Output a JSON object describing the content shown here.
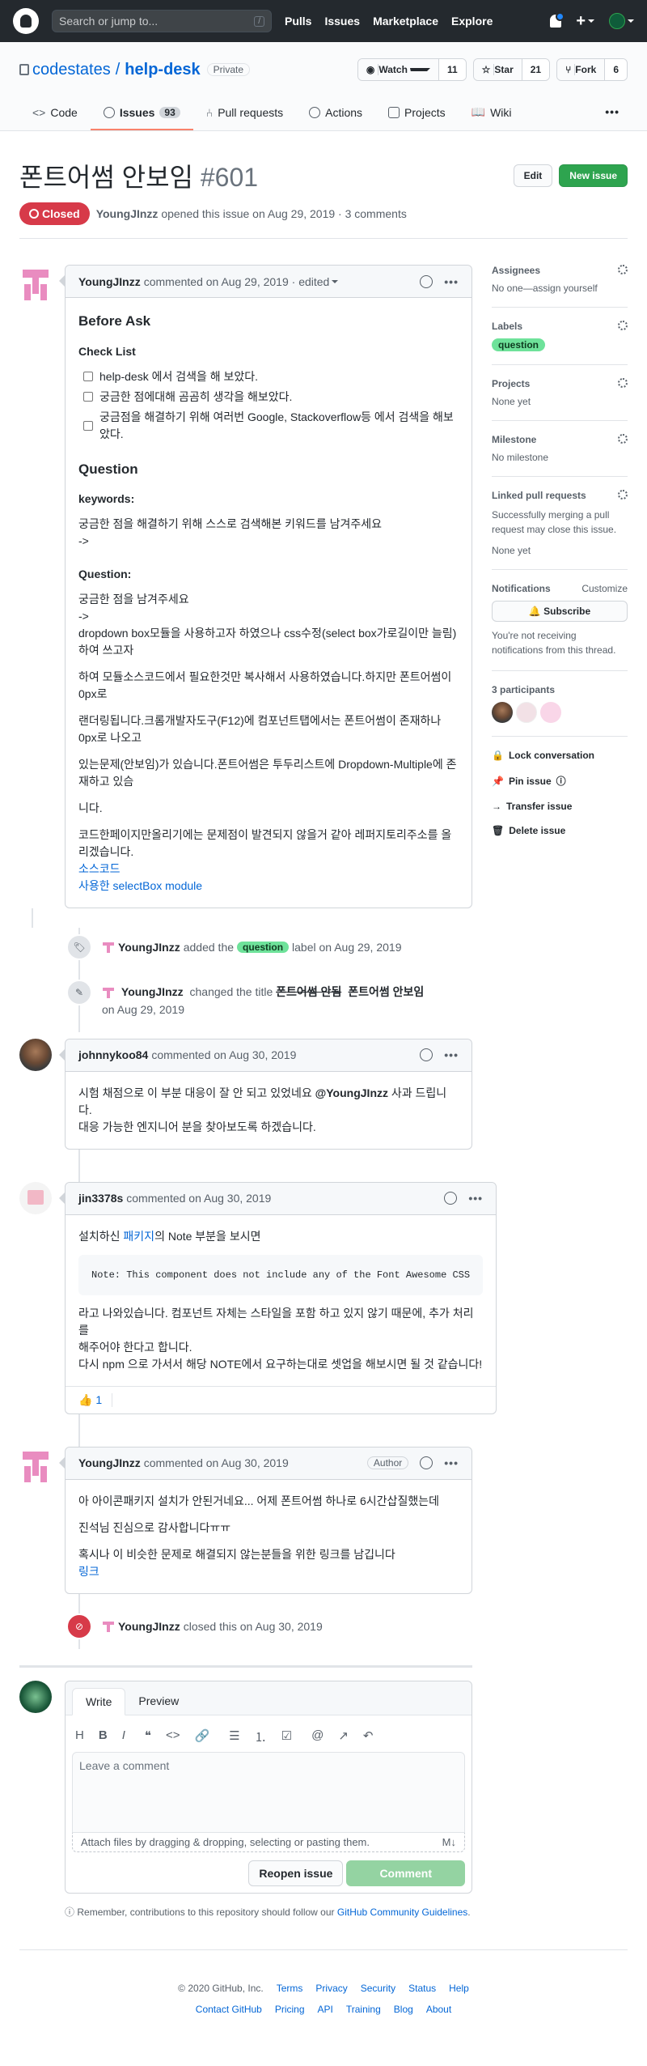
{
  "header": {
    "search_placeholder": "Search or jump to...",
    "slash": "/",
    "nav": [
      "Pulls",
      "Issues",
      "Marketplace",
      "Explore"
    ],
    "plus": "+"
  },
  "repo": {
    "owner": "codestates",
    "name": "help-desk",
    "visibility": "Private",
    "watch_label": "Watch",
    "watch_count": "11",
    "star_label": "Star",
    "star_count": "21",
    "fork_label": "Fork",
    "fork_count": "6",
    "tabs": [
      {
        "label": "Code"
      },
      {
        "label": "Issues",
        "count": "93"
      },
      {
        "label": "Pull requests"
      },
      {
        "label": "Actions"
      },
      {
        "label": "Projects"
      },
      {
        "label": "Wiki"
      }
    ],
    "more": "•••"
  },
  "issue": {
    "title": "폰트어썸 안보임",
    "number": "#601",
    "edit_label": "Edit",
    "new_issue_label": "New issue",
    "state": "Closed",
    "author": "YoungJInzz",
    "meta_text": "opened this issue on Aug 29, 2019 · 3 comments"
  },
  "first_comment": {
    "author": "YoungJInzz",
    "meta": "commented on Aug 29, 2019 · edited",
    "h_before": "Before Ask",
    "h_checklist": "Check List",
    "checklist": [
      "help-desk 에서 검색을 해 보았다.",
      "궁금한 점에대해 곰곰히 생각을 해보았다.",
      "궁금점을 해결하기 위해 여러번 Google, Stackoverflow등 에서 검색을 해보았다."
    ],
    "h_question": "Question",
    "h_keywords": "keywords:",
    "keywords_text": "궁금한 점을 해결하기 위해 스스로 검색해본 키워드를 남겨주세요",
    "arrow1": "->",
    "h_question2": "Question:",
    "q_text": "궁금한 점을 남겨주세요",
    "arrow2": "->",
    "p1": "dropdown box모듈을 사용하고자 하였으나 css수정(select box가로길이만 늘림)하여 쓰고자",
    "p2": "하여 모듈소스코드에서 필요한것만 복사해서 사용하였습니다.하지만 폰트어썸이 0px로",
    "p3": "랜더링됩니다.크롬개발자도구(F12)에 컴포넌트탭에서는 폰트어썸이 존재하나 0px로 나오고",
    "p4": "있는문제(안보임)가 있습니다.폰트어썸은 투두리스트에 Dropdown-Multiple에 존재하고 있슴",
    "p5": "니다.",
    "p6": "코드한페이지만올리기에는 문제점이 발견되지 않을거 같아 레퍼지토리주소를 올리겠습니다.",
    "link1": "소스코드",
    "link2": "사용한 selectBox module"
  },
  "event_label": {
    "actor": "YoungJInzz",
    "pre": "added the",
    "label": "question",
    "post": "label on Aug 29, 2019"
  },
  "event_rename": {
    "actor": "YoungJInzz",
    "pre": "changed the title",
    "old": "폰트어썸 안됨",
    "new": "폰트어썸 안보임",
    "date": "on Aug 29, 2019"
  },
  "comment2": {
    "author": "johnnykoo84",
    "meta": "commented on Aug 30, 2019",
    "line1_pre": "시험 채점으로 이 부분 대응이 잘 안 되고 있었네요",
    "mention": "@YoungJInzz",
    "line1_post": "사과 드립니다.",
    "line2": "대응 가능한 엔지니어 분을 찾아보도록 하겠습니다."
  },
  "comment3": {
    "author": "jin3378s",
    "meta": "commented on Aug 30, 2019",
    "pre": "설치하신",
    "link": "패키지",
    "post": "의 Note 부분을 보시면",
    "code": "Note: This component does not include any of the Font Awesome CSS",
    "l2": "라고 나와있습니다. 컴포넌트 자체는 스타일을 포함 하고 있지 않기 때문에, 추가 처리를",
    "l3": "해주어야 한다고 합니다.",
    "l4": "다시 npm 으로 가서서 해당 NOTE에서 요구하는대로 셋업을 해보시면 될 것 같습니다!",
    "reaction": "👍 1"
  },
  "comment4": {
    "author": "YoungJInzz",
    "meta": "commented on Aug 30, 2019",
    "badge": "Author",
    "l1": "아 아이콘패키지 설치가 안된거네요... 어제 폰트어썸 하나로 6시간삽질했는데",
    "l2": "진석님 진심으로 감사합니다ㅠㅠ",
    "l3": "혹시나 이 비슷한 문제로 해결되지 않는분들을 위한 링크를 남깁니다",
    "link": "링크"
  },
  "event_closed": {
    "actor": "YoungJInzz",
    "text": "closed this on Aug 30, 2019"
  },
  "editor": {
    "tab_write": "Write",
    "tab_preview": "Preview",
    "tools": [
      "H",
      "B",
      "I",
      "❝",
      "<>",
      "🔗",
      "☰",
      "⒈",
      "☑",
      "@",
      "↗",
      "↶"
    ],
    "placeholder": "Leave a comment",
    "attach": "Attach files by dragging & dropping, selecting or pasting them.",
    "md": "M↓",
    "reopen": "Reopen issue",
    "comment": "Comment",
    "remember_pre": "Remember, contributions to this repository should follow our",
    "remember_link": "GitHub Community Guidelines",
    "remember_post": "."
  },
  "sidebar": {
    "assignees_h": "Assignees",
    "assignees_v": "No one—assign yourself",
    "labels_h": "Labels",
    "labels_v": "question",
    "projects_h": "Projects",
    "projects_v": "None yet",
    "milestone_h": "Milestone",
    "milestone_v": "No milestone",
    "linked_h": "Linked pull requests",
    "linked_v1": "Successfully merging a pull request may close this issue.",
    "linked_v2": "None yet",
    "notif_h": "Notifications",
    "notif_customize": "Customize",
    "subscribe": "Subscribe",
    "notif_v": "You're not receiving notifications from this thread.",
    "participants_h": "3 participants",
    "lock": "Lock conversation",
    "pin": "Pin issue",
    "transfer": "Transfer issue",
    "delete": "Delete issue"
  },
  "footer": {
    "copy": "© 2020 GitHub, Inc.",
    "row1": [
      "Terms",
      "Privacy",
      "Security",
      "Status",
      "Help"
    ],
    "row2": [
      "Contact GitHub",
      "Pricing",
      "API",
      "Training",
      "Blog",
      "About"
    ]
  },
  "colors": {
    "header_bg": "#24292e",
    "closed": "#d73a49",
    "green": "#2ea44f",
    "label": "#6ee29a",
    "link": "#0366d6"
  }
}
